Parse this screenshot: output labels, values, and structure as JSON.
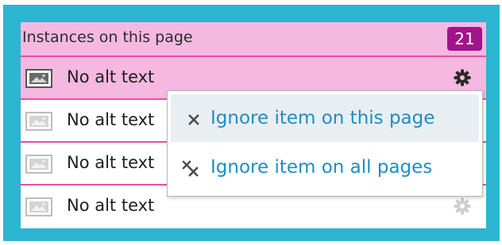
{
  "panel": {
    "title": "Instances on this page",
    "count": "21"
  },
  "rows": [
    {
      "label": "No alt text",
      "icon": "image-icon"
    },
    {
      "label": "No alt text",
      "icon": "image-icon"
    },
    {
      "label": "No alt text",
      "icon": "image-icon"
    },
    {
      "label": "No alt text",
      "icon": "image-icon"
    }
  ],
  "menu": {
    "items": [
      {
        "label": "Ignore item on this page",
        "icon": "close-icon"
      },
      {
        "label": "Ignore item on all pages",
        "icon": "close-all-icon"
      }
    ]
  },
  "colors": {
    "frame": "#2bb5d1",
    "header_bg": "#f4b8e1",
    "divider": "#e54fa8",
    "badge": "#a1148a",
    "menu_text": "#1d8fbf"
  }
}
